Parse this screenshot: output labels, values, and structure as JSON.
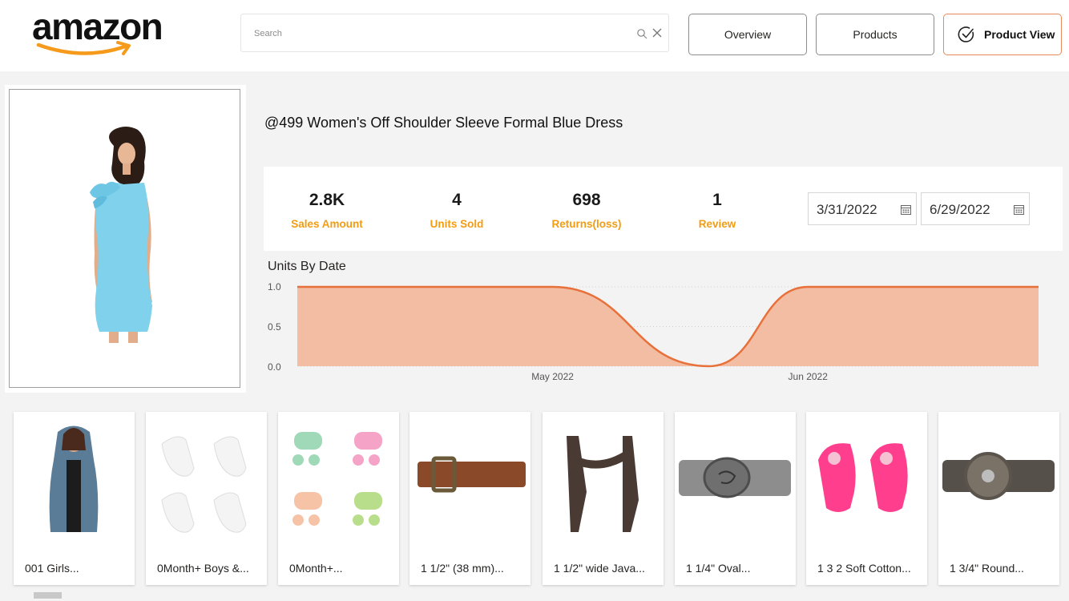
{
  "header": {
    "logo_text": "amazon",
    "search": {
      "placeholder": "Search",
      "value": ""
    },
    "nav": [
      {
        "label": "Overview",
        "active": false
      },
      {
        "label": "Products",
        "active": false
      },
      {
        "label": "Product View",
        "active": true
      }
    ],
    "icons": {
      "search": "search-icon",
      "clear": "close-icon",
      "active_nav": "check-circle-icon"
    }
  },
  "product": {
    "title": "@499 Women's Off Shoulder Sleeve Formal Blue Dress",
    "image": "blue-off-shoulder-dress-photo"
  },
  "kpis": [
    {
      "value": "2.8K",
      "label": "Sales Amount"
    },
    {
      "value": "4",
      "label": "Units Sold"
    },
    {
      "value": "698",
      "label": "Returns(loss)"
    },
    {
      "value": "1",
      "label": "Review"
    }
  ],
  "date_range": {
    "start": "3/31/2022",
    "end": "6/29/2022"
  },
  "chart_title": "Units By Date",
  "chart_data": {
    "type": "area",
    "title": "Units By Date",
    "xlabel": "",
    "ylabel": "",
    "x_ticks": [
      "May 2022",
      "Jun 2022"
    ],
    "y_ticks": [
      "1.0",
      "0.5",
      "0.0"
    ],
    "ylim": [
      0,
      1
    ],
    "x": [
      "2022-03-31",
      "2022-05-01",
      "2022-05-20",
      "2022-06-01",
      "2022-06-29"
    ],
    "values": [
      1,
      1,
      0,
      1,
      1
    ],
    "grid": true,
    "colors": {
      "line": "#e8703a",
      "fill": "#f2bda2"
    }
  },
  "related_products": [
    {
      "caption": "001 Girls...",
      "image": "denim-vest-photo"
    },
    {
      "caption": "0Month+ Boys &...",
      "image": "white-socks-photo"
    },
    {
      "caption": "0Month+...",
      "image": "baby-caps-mittens-photo"
    },
    {
      "caption": "1 1/2\" (38 mm)...",
      "image": "brown-belt-photo"
    },
    {
      "caption": "1 1/2\" wide Java...",
      "image": "suspenders-photo"
    },
    {
      "caption": "1 1/4\" Oval...",
      "image": "oval-buckle-belt-photo"
    },
    {
      "caption": "1 3 2 Soft Cotton...",
      "image": "pink-baby-socks-photo"
    },
    {
      "caption": "1 3/4\" Round...",
      "image": "round-concho-belt-photo"
    }
  ],
  "colors": {
    "accent_orange": "#f39c12",
    "active_border": "#e8895a",
    "chart_line": "#e8703a",
    "chart_fill": "#f2bda2"
  }
}
